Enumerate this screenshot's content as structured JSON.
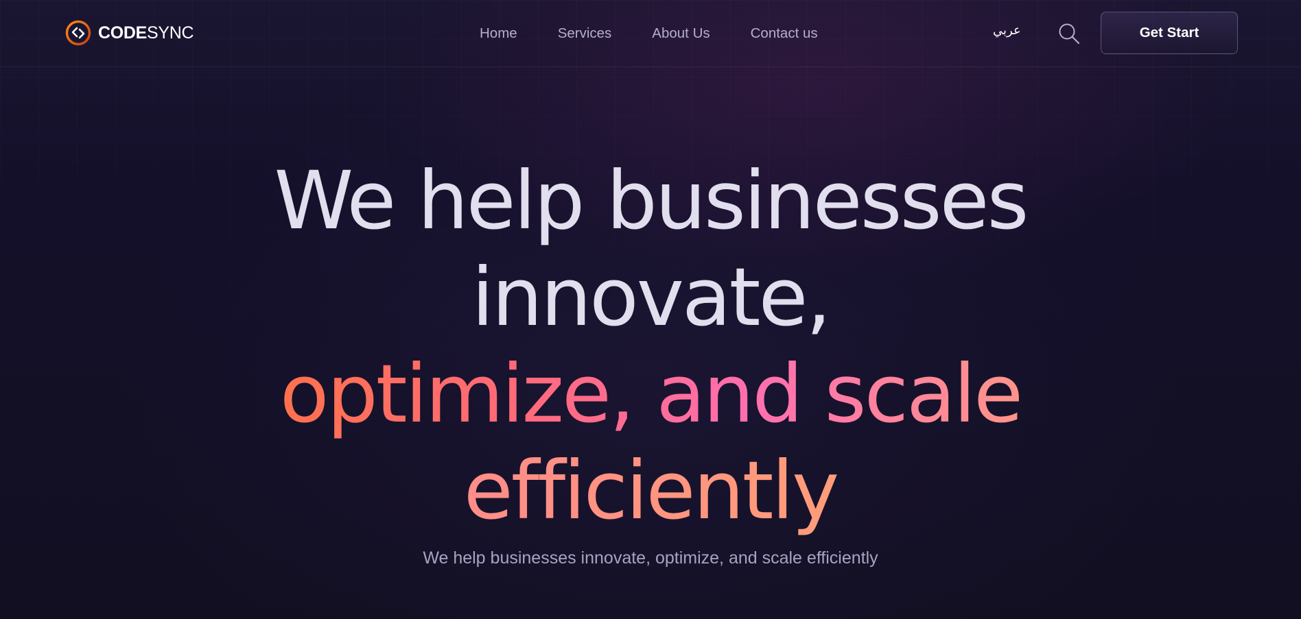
{
  "brand": {
    "name_bold": "CODE",
    "name_light": "SYNC",
    "accent": "#ff7a18"
  },
  "nav": {
    "items": [
      {
        "label": "Home"
      },
      {
        "label": "Services"
      },
      {
        "label": "About Us"
      },
      {
        "label": "Contact us"
      }
    ]
  },
  "header": {
    "language_toggle": "عربي",
    "search_icon": "search-icon",
    "cta_label": "Get Start"
  },
  "hero": {
    "headline_line1": "We help businesses",
    "headline_line2": "innovate,",
    "headline_line3": "optimize, and scale",
    "headline_line4": "efficiently",
    "subtitle": "We help businesses innovate, optimize, and scale efficiently"
  },
  "colors": {
    "background": "#13101f",
    "headline_white": "#e1deee",
    "gradient_start": "#ff7a18",
    "gradient_mid": "#ff6fb0",
    "gradient_end": "#ffb060",
    "subtitle": "#a8a3c4"
  }
}
